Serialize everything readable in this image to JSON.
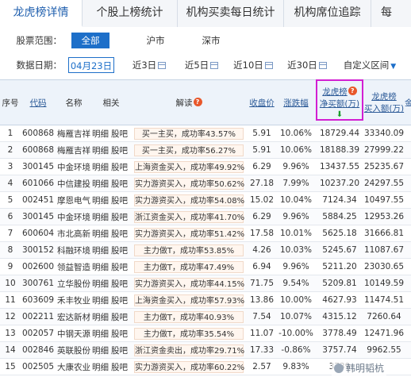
{
  "tabs": [
    "龙虎榜详情",
    "个股上榜统计",
    "机构买卖每日统计",
    "机构席位追踪",
    "每"
  ],
  "filters": {
    "scope_label": "股票范围：",
    "scope_options": [
      "全部",
      "沪市",
      "深市"
    ],
    "date_label": "数据日期：",
    "date_value": "04月23日",
    "date_options": [
      "近3日",
      "近5日",
      "近10日",
      "近30日",
      "自定义区间"
    ]
  },
  "columns": [
    "序号",
    "代码",
    "名称",
    "相关",
    "解读",
    "收盘价",
    "涨跌幅",
    "龙虎榜",
    "净买额(万)",
    "龙虎榜",
    "买入额(万)",
    "金"
  ],
  "related_links": [
    "明细",
    "股吧"
  ],
  "rows": [
    [
      "1",
      "600868",
      "梅雁吉祥",
      "买一主买，成功率43.57%",
      "5.91",
      "10.06%",
      "18729.44",
      "33340.09"
    ],
    [
      "2",
      "600868",
      "梅雁吉祥",
      "买一主买，成功率56.27%",
      "5.91",
      "10.06%",
      "18188.39",
      "27999.22"
    ],
    [
      "3",
      "300145",
      "中金环境",
      "上海资金买入，成功率49.92%",
      "6.29",
      "9.96%",
      "13437.55",
      "25235.67"
    ],
    [
      "4",
      "601066",
      "中信建投",
      "实力游资买入，成功率50.62%",
      "27.18",
      "7.99%",
      "10237.20",
      "24297.55"
    ],
    [
      "5",
      "002451",
      "摩恩电气",
      "实力游资买入，成功率54.08%",
      "15.02",
      "10.04%",
      "7124.34",
      "10497.55"
    ],
    [
      "6",
      "300145",
      "中金环境",
      "浙江资金买入，成功率41.70%",
      "6.29",
      "9.96%",
      "5884.25",
      "12953.26"
    ],
    [
      "7",
      "600604",
      "市北高新",
      "实力游资买入，成功率51.42%",
      "17.58",
      "10.01%",
      "5625.18",
      "31666.81"
    ],
    [
      "8",
      "300152",
      "科融环境",
      "主力做T，成功率53.85%",
      "4.26",
      "10.03%",
      "5245.67",
      "11087.67"
    ],
    [
      "9",
      "002600",
      "领益智造",
      "主力做T，成功率47.49%",
      "6.94",
      "9.96%",
      "5211.20",
      "23030.65"
    ],
    [
      "10",
      "300761",
      "立华股份",
      "实力游资买入，成功率44.15%",
      "71.75",
      "9.54%",
      "5209.81",
      "10149.59"
    ],
    [
      "11",
      "603609",
      "禾丰牧业",
      "上海资金买入，成功率57.93%",
      "13.86",
      "10.00%",
      "4627.93",
      "11474.51"
    ],
    [
      "12",
      "002211",
      "宏达新材",
      "主力做T，成功率40.93%",
      "7.54",
      "10.07%",
      "4315.12",
      "7260.64"
    ],
    [
      "13",
      "002057",
      "中钢天源",
      "主力做T，成功率35.54%",
      "11.07",
      "-10.00%",
      "3778.49",
      "12471.96"
    ],
    [
      "14",
      "002846",
      "英联股份",
      "浙江资金卖出，成功率29.71%",
      "17.33",
      "-0.86%",
      "3757.74",
      "9962.55"
    ],
    [
      "15",
      "002505",
      "大康农业",
      "实力游资买入，成功率60.22%",
      "2.57",
      "9.83%",
      "3739",
      ""
    ]
  ],
  "watermark": "韩明韬杭",
  "colors": {
    "up": "#e02020",
    "down": "#1a9b2a",
    "accent": "#1d6fc9",
    "highlight": "#d21fd2"
  }
}
